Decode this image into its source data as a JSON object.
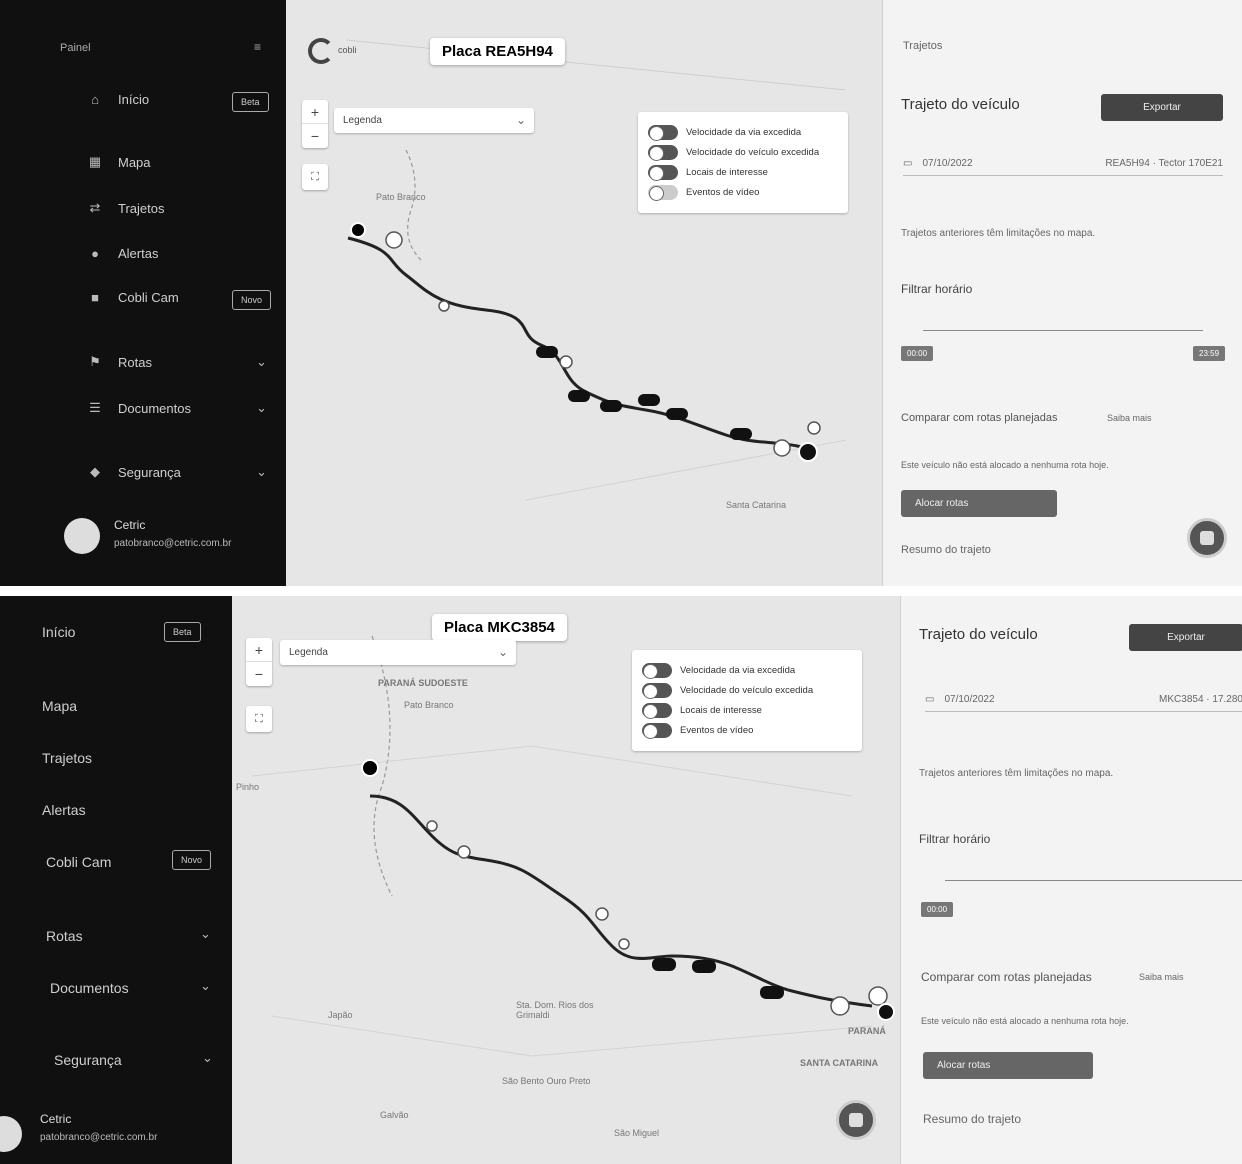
{
  "top": {
    "plate": "Placa REA5H94",
    "sidebar": {
      "title": "Painel",
      "items": [
        {
          "label": "Início",
          "badge": "Beta"
        },
        {
          "label": "Mapa"
        },
        {
          "label": "Trajetos"
        },
        {
          "label": "Alertas"
        },
        {
          "label": "Cobli Cam",
          "badge": "Novo"
        },
        {
          "label": "Rotas"
        },
        {
          "label": "Documentos"
        },
        {
          "label": "Segurança"
        }
      ],
      "user": {
        "name": "Cetric",
        "email": "patobranco@cetric.com.br"
      }
    },
    "map": {
      "brand": "cobli",
      "legend_label": "Legenda",
      "legend": [
        {
          "label": "Velocidade da via excedida",
          "on": true
        },
        {
          "label": "Velocidade do veículo excedida",
          "on": true
        },
        {
          "label": "Locais de interesse",
          "on": true
        },
        {
          "label": "Eventos de vídeo",
          "on": false
        }
      ],
      "places": {
        "city": "Pato Branco",
        "area": "Santa Catarina"
      }
    },
    "right": {
      "header": "Trajetos",
      "title": "Trajeto do veículo",
      "export": "Exportar",
      "date": "07/10/2022",
      "vehicle": "REA5H94 · Tector 170E21",
      "info": "Trajetos anteriores têm limitações no mapa.",
      "filter": "Filtrar horário",
      "t_start": "00:00",
      "t_end": "23:59",
      "compare": "Comparar com rotas planejadas",
      "compare_tag": "Saiba mais",
      "compare_note": "Este veículo não está alocado a nenhuma rota hoje.",
      "add_route": "Alocar rotas",
      "summary": "Resumo do trajeto"
    }
  },
  "bottom": {
    "plate": "Placa MKC3854",
    "sidebar": {
      "items": [
        {
          "label": "Início",
          "badge": "Beta"
        },
        {
          "label": "Mapa"
        },
        {
          "label": "Trajetos"
        },
        {
          "label": "Alertas"
        },
        {
          "label": "Cobli Cam",
          "badge": "Novo"
        },
        {
          "label": "Rotas"
        },
        {
          "label": "Documentos"
        },
        {
          "label": "Segurança"
        }
      ],
      "user": {
        "name": "Cetric",
        "email": "patobranco@cetric.com.br"
      }
    },
    "map": {
      "legend_label": "Legenda",
      "legend": [
        {
          "label": "Velocidade da via excedida",
          "on": true
        },
        {
          "label": "Velocidade do veículo excedida",
          "on": true
        },
        {
          "label": "Locais de interesse",
          "on": true
        },
        {
          "label": "Eventos de vídeo",
          "on": true
        }
      ],
      "places": {
        "region": "PARANÁ SUDOESTE",
        "city": "Pato Branco",
        "west": "Pinho",
        "town1": "Japão",
        "town2": "Sta. Dom. Rios dos Grimaldi",
        "town3": "São Bento Ouro Preto",
        "town4": "São Miguel",
        "state1": "PARANÁ",
        "state2": "SANTA CATARINA",
        "south": "Galvão"
      }
    },
    "right": {
      "title": "Trajeto do veículo",
      "export": "Exportar",
      "date": "07/10/2022",
      "vehicle": "MKC3854 · 17.280",
      "info": "Trajetos anteriores têm limitações no mapa.",
      "filter": "Filtrar horário",
      "t_start": "00:00",
      "compare": "Comparar com rotas planejadas",
      "compare_tag": "Saiba mais",
      "compare_note": "Este veículo não está alocado a nenhuma rota hoje.",
      "add_route": "Alocar rotas",
      "summary": "Resumo do trajeto"
    }
  }
}
